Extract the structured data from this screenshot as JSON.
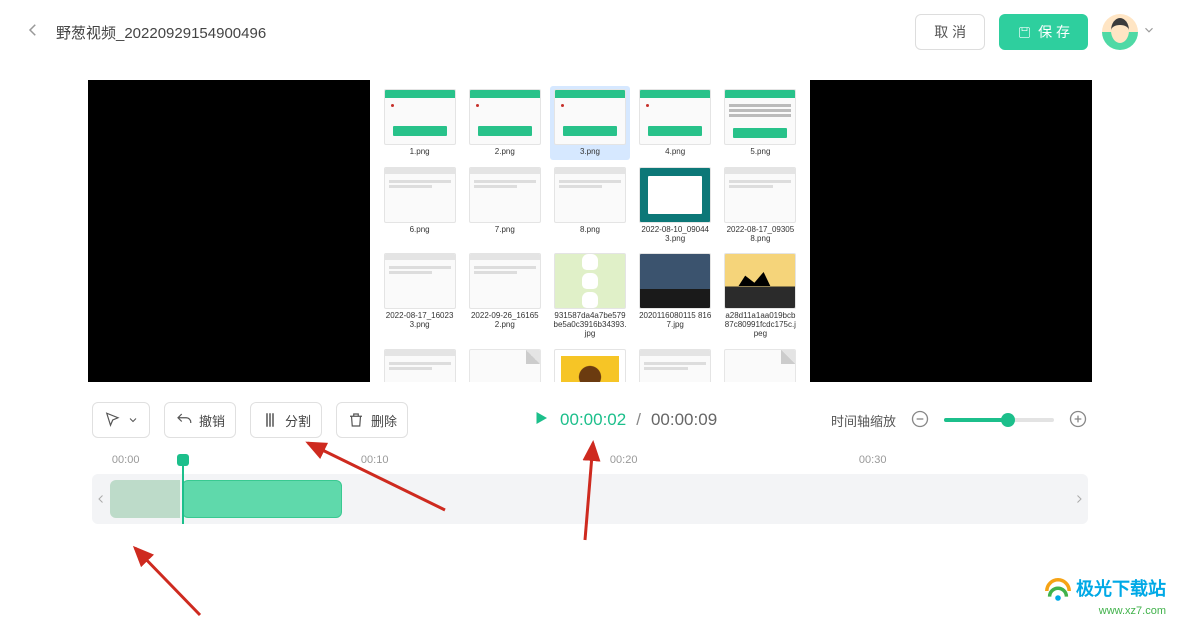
{
  "header": {
    "title": "野葱视频_20220929154900496",
    "cancel": "取 消",
    "save": "保 存"
  },
  "grid": [
    {
      "name": "1.png",
      "type": "app"
    },
    {
      "name": "2.png",
      "type": "app"
    },
    {
      "name": "3.png",
      "type": "app",
      "selected": true
    },
    {
      "name": "4.png",
      "type": "app"
    },
    {
      "name": "5.png",
      "type": "text"
    },
    {
      "name": "6.png",
      "type": "win"
    },
    {
      "name": "7.png",
      "type": "win"
    },
    {
      "name": "8.png",
      "type": "win"
    },
    {
      "name": "2022-08-10_090443.png",
      "type": "teal"
    },
    {
      "name": "2022-08-17_093058.png",
      "type": "win"
    },
    {
      "name": "2022-08-17_160233.png",
      "type": "win"
    },
    {
      "name": "2022-09-26_161652.png",
      "type": "win"
    },
    {
      "name": "931587da4a7be579be5a0c3916b34393.jpg",
      "type": "dog"
    },
    {
      "name": "2020116080115 8167.jpg",
      "type": "land"
    },
    {
      "name": "a28d11a1aa019bcb87c80991fcdc175c.jpeg",
      "type": "sil"
    },
    {
      "name": "",
      "type": "win"
    },
    {
      "name": "",
      "type": "blank"
    },
    {
      "name": "",
      "type": "sun"
    },
    {
      "name": "",
      "type": "win"
    },
    {
      "name": "",
      "type": "blank"
    }
  ],
  "controls": {
    "undo": "撤销",
    "split": "分割",
    "delete": "删除"
  },
  "time": {
    "current": "00:00:02",
    "total": "00:00:09",
    "sep": "/"
  },
  "zoom": {
    "label": "时间轴缩放"
  },
  "ruler": [
    "00:00",
    "00:10",
    "00:20",
    "00:30"
  ],
  "watermark": {
    "brand": "极光下载站",
    "url": "www.xz7.com"
  }
}
